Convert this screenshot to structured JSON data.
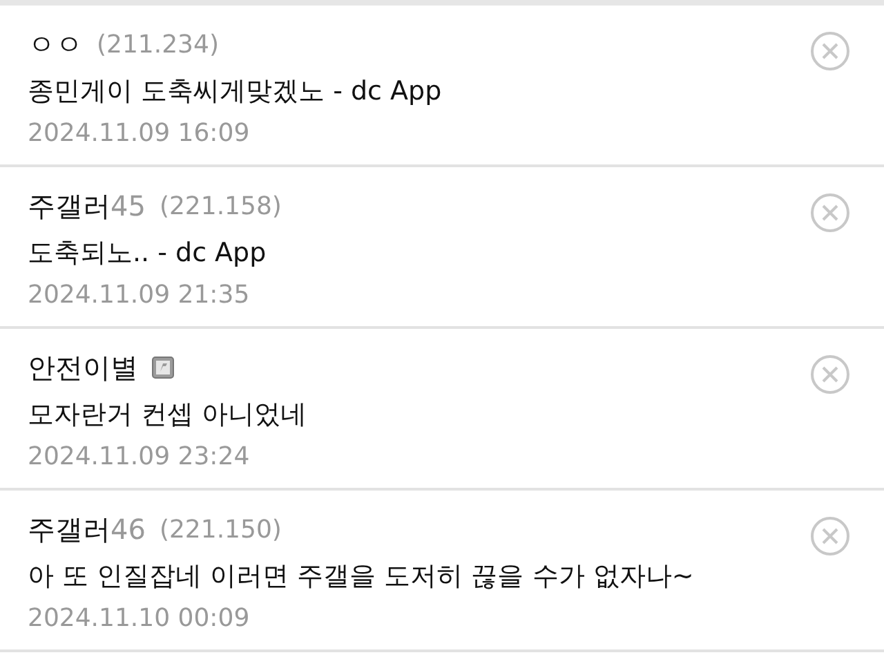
{
  "comments": [
    {
      "name": "ㅇㅇ",
      "ip": "(211.234)",
      "badge": false,
      "text": "종민게이 도축씨게맞겠노 - dc App",
      "date": "2024.11.09 16:09"
    },
    {
      "name": "주갤러",
      "name_suffix": "45",
      "ip": "(221.158)",
      "badge": false,
      "text": "도축되노.. - dc App",
      "date": "2024.11.09 21:35"
    },
    {
      "name": "안전이별",
      "badge": true,
      "text": "모자란거 컨셉 아니었네",
      "date": "2024.11.09 23:24"
    },
    {
      "name": "주갤러",
      "name_suffix": "46",
      "ip": "(221.150)",
      "badge": false,
      "text": "아 또 인질잡네 이러면 주갤을 도저히 끊을 수가 없자나~",
      "date": "2024.11.10 00:09"
    }
  ]
}
